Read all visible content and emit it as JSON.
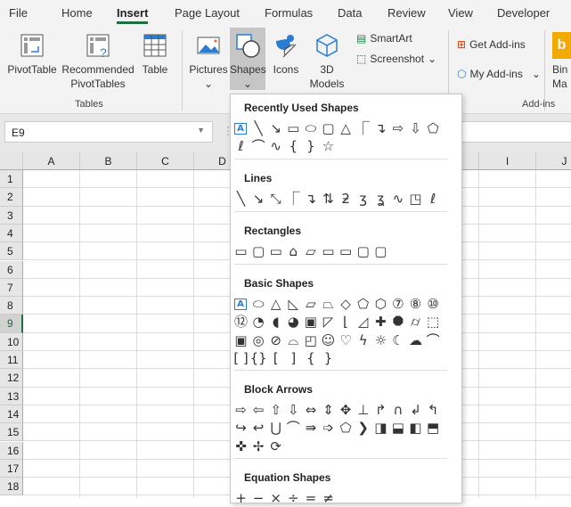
{
  "tabs": [
    "File",
    "Home",
    "Insert",
    "Page Layout",
    "Formulas",
    "Data",
    "Review",
    "View",
    "Developer"
  ],
  "active_tab": "Insert",
  "ribbon": {
    "pivottable": "PivotTable",
    "recommended1": "Recommended",
    "recommended2": "PivotTables",
    "table": "Table",
    "tables_group": "Tables",
    "pictures": "Pictures",
    "shapes": "Shapes",
    "icons": "Icons",
    "models1": "3D",
    "models2": "Models",
    "smartart": "SmartArt",
    "screenshot": "Screenshot",
    "get_addins": "Get Add-ins",
    "my_addins": "My Add-ins",
    "addins_group": "Add-ins",
    "bing1": "Bin",
    "bing2": "Ma"
  },
  "name_box": "E9",
  "columns": [
    "A",
    "B",
    "C",
    "D",
    "E",
    "F",
    "G",
    "H",
    "I",
    "J"
  ],
  "rows": [
    "1",
    "2",
    "3",
    "4",
    "5",
    "6",
    "7",
    "8",
    "9",
    "10",
    "11",
    "12",
    "13",
    "14",
    "15",
    "16",
    "17",
    "18"
  ],
  "selected_row": "9",
  "shapes_menu": {
    "sections": [
      {
        "title": "Recently Used Shapes",
        "rows": [
          [
            "text-box",
            "line",
            "arrow-line",
            "rectangle",
            "oval",
            "rounded-rectangle",
            "triangle",
            "elbow-connector",
            "elbow-arrow",
            "right-arrow",
            "down-arrow",
            "snip-rectangle"
          ],
          [
            "scribble",
            "arc",
            "curve",
            "left-brace",
            "right-brace",
            "star"
          ]
        ]
      },
      {
        "title": "Lines",
        "rows": [
          [
            "line",
            "arrow",
            "double-arrow",
            "elbow",
            "elbow-arrow",
            "elbow-double-arrow",
            "curved",
            "curved-arrow",
            "curved-double-arrow",
            "curve",
            "freeform",
            "scribble"
          ]
        ]
      },
      {
        "title": "Rectangles",
        "rows": [
          [
            "rectangle",
            "rounded-rectangle",
            "snip-single",
            "snip-same",
            "snip-diagonal",
            "snip-round",
            "round-single",
            "round-same",
            "round-diagonal"
          ]
        ]
      },
      {
        "title": "Basic Shapes",
        "rows": [
          [
            "text-box",
            "oval",
            "triangle",
            "right-triangle",
            "parallelogram",
            "trapezoid",
            "diamond",
            "pentagon",
            "hexagon",
            "heptagon",
            "octagon",
            "decagon"
          ],
          [
            "dodecagon",
            "pie",
            "chord",
            "teardrop",
            "frame",
            "half-frame",
            "l-shape",
            "diagonal-stripe",
            "cross",
            "plaque",
            "can",
            "cube"
          ],
          [
            "bevel",
            "donut",
            "no-symbol",
            "block-arc",
            "folded-corner",
            "smiley",
            "heart",
            "lightning",
            "sun",
            "moon",
            "cloud",
            "arc"
          ],
          [
            "double-bracket",
            "double-brace",
            "left-bracket",
            "right-bracket",
            "left-brace",
            "right-brace"
          ]
        ]
      },
      {
        "title": "Block Arrows",
        "rows": [
          [
            "right-arrow",
            "left-arrow",
            "up-arrow",
            "down-arrow",
            "left-right-arrow",
            "up-down-arrow",
            "quad-arrow",
            "left-right-up-arrow",
            "bent-arrow",
            "u-turn-arrow",
            "left-up-arrow",
            "bent-up-arrow"
          ],
          [
            "curved-right",
            "curved-left",
            "curved-up",
            "curved-down",
            "striped-right",
            "notched-right",
            "pentagon-arrow",
            "chevron",
            "right-callout",
            "down-callout",
            "left-callout",
            "up-callout"
          ],
          [
            "quad-callout",
            "left-right-callout",
            "circular-arrow"
          ]
        ]
      },
      {
        "title": "Equation Shapes",
        "rows": [
          [
            "plus",
            "minus",
            "multiply",
            "divide",
            "equal",
            "not-equal"
          ]
        ]
      }
    ]
  },
  "colors": {
    "accent": "#1e6e42",
    "selected_tool": "#c6c6c6",
    "text_box": "#2b7cd3"
  }
}
